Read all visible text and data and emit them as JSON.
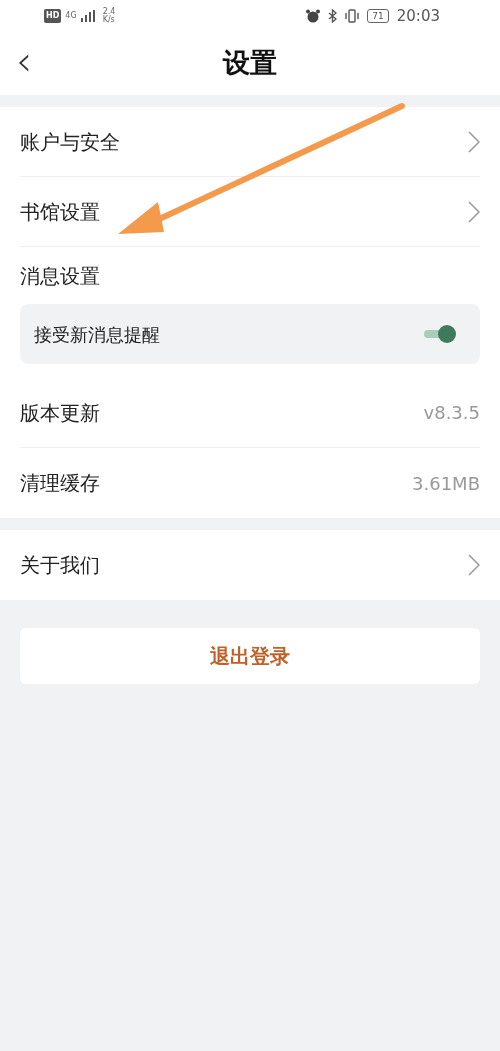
{
  "status_bar": {
    "hd_badge": "HD",
    "network_type": "4G",
    "speed": "2.4",
    "speed_unit": "K/s",
    "battery": "71",
    "time": "20:03"
  },
  "header": {
    "back": "‹",
    "title": "设置"
  },
  "sections": [
    {
      "items": [
        {
          "kind": "link",
          "label": "账户与安全"
        },
        {
          "kind": "link",
          "label": "书馆设置"
        },
        {
          "kind": "header",
          "label": "消息设置"
        },
        {
          "kind": "toggle",
          "label": "接受新消息提醒",
          "on": true
        },
        {
          "kind": "value",
          "label": "版本更新",
          "value": "v8.3.5"
        },
        {
          "kind": "value",
          "label": "清理缓存",
          "value": "3.61MB"
        }
      ]
    },
    {
      "items": [
        {
          "kind": "link",
          "label": "关于我们"
        }
      ]
    }
  ],
  "logout_button": "退出登录"
}
